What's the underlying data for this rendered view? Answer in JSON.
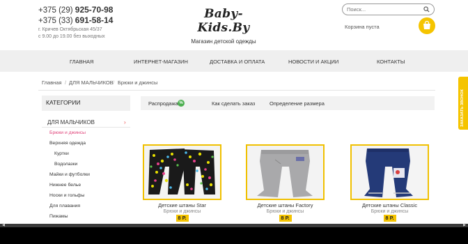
{
  "header": {
    "phone1_prefix": "+375 (29)",
    "phone1_number": "925-70-98",
    "phone2_prefix": "+375 (33)",
    "phone2_number": "691-58-14",
    "address": "г. Кричев Октябрьская 45/37",
    "hours": "с 9.00 до 19.00 без выходных",
    "logo": "Baby-Kids.By",
    "tagline": "Магазин детской одежды",
    "search_placeholder": "Поиск...",
    "cart_text": "Корзина пуста"
  },
  "nav": {
    "items": [
      "ГЛАВНАЯ",
      "ИНТЕРНЕТ-МАГАЗИН",
      "ДОСТАВКА И ОПЛАТА",
      "НОВОСТИ И АКЦИИ",
      "КОНТАКТЫ"
    ]
  },
  "breadcrumb": [
    "Главная",
    "ДЛЯ МАЛЬЧИКОВ",
    "Брюки и джинсы"
  ],
  "sidebar": {
    "header": "КАТЕГОРИИ",
    "main": "ДЛЯ МАЛЬЧИКОВ",
    "items": [
      "Брюки и джинсы",
      "Верхняя одежда",
      "Куртки",
      "Водолазки",
      "Майки и футболки",
      "Нижнее белье",
      "Носки и гольфы",
      "Для плавания",
      "Пижамы"
    ]
  },
  "tabs": {
    "sale": "Распродажа",
    "sale_badge": "%",
    "order": "Как сделать заказ",
    "size": "Определение размера"
  },
  "products": [
    {
      "title": "Детские штаны Star",
      "category": "Брюки и джинсы",
      "price": "8 Р."
    },
    {
      "title": "Детские штаны Factory",
      "category": "Брюки и джинсы",
      "price": "8 Р."
    },
    {
      "title": "Детские штаны Classic",
      "category": "Брюки и джинсы",
      "price": "8 Р."
    }
  ],
  "side_tab": "ЗАКАЗАТЬ ЗВОНОК",
  "colors": {
    "accent": "#f5c400",
    "active_link": "#e0447a",
    "sale_badge": "#4caf50"
  }
}
